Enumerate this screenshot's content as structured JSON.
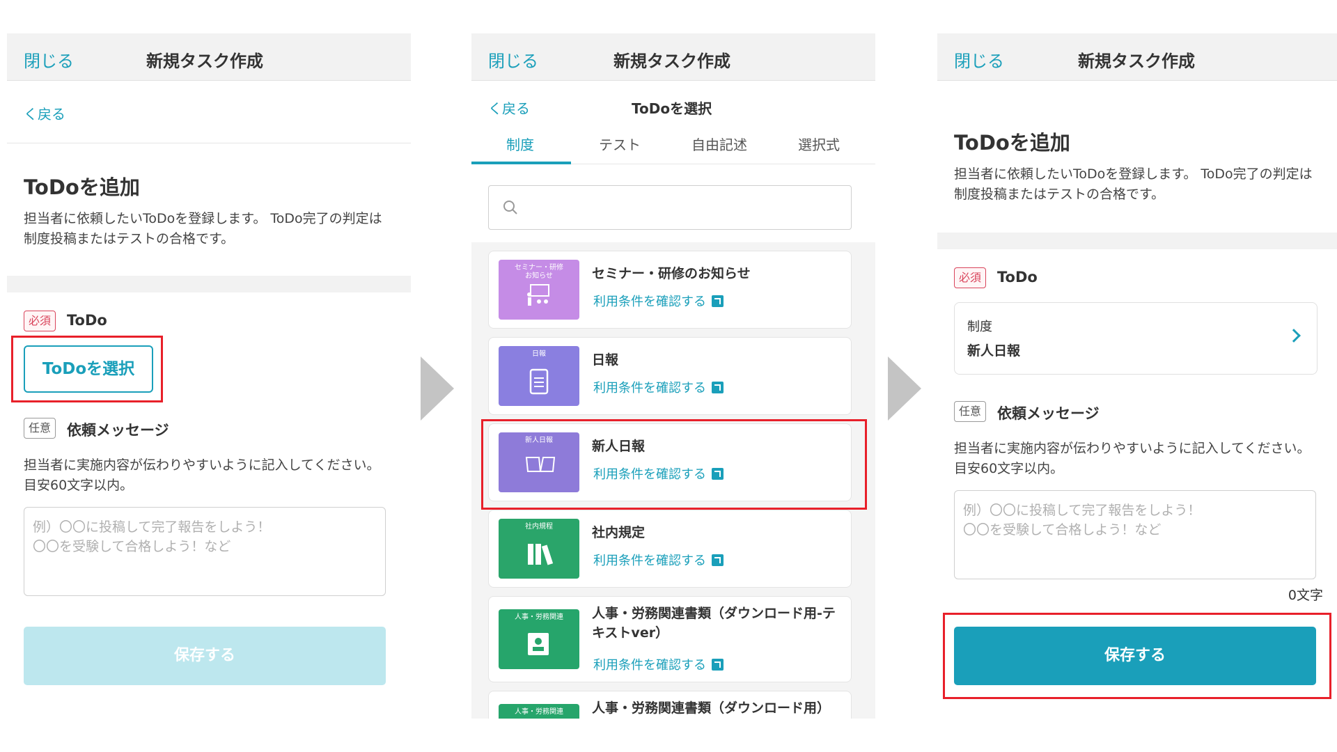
{
  "header": {
    "close_label": "閉じる",
    "title": "新規タスク作成"
  },
  "nav": {
    "back_label": "く戻る"
  },
  "add_section": {
    "title": "ToDoを追加",
    "description": "担当者に依頼したいToDoを登録します。 ToDo完了の判定は制度投稿またはテストの合格です。"
  },
  "todo_field": {
    "required_badge": "必須",
    "label": "ToDo",
    "select_button": "ToDoを選択"
  },
  "message_field": {
    "optional_badge": "任意",
    "label": "依頼メッセージ",
    "description": "担当者に実施内容が伝わりやすいように記入してください。目安60文字以内。",
    "placeholder": "例）〇〇に投稿して完了報告をしよう！\n〇〇を受験して合格しよう！など"
  },
  "save_label": "保存する",
  "char_count": "0文字",
  "picker": {
    "title": "ToDoを選択",
    "tabs": [
      "制度",
      "テスト",
      "自由記述",
      "選択式"
    ],
    "active_tab": "制度",
    "search_placeholder": "",
    "link_label": "利用条件を確認する",
    "items": [
      {
        "title": "セミナー・研修のお知らせ",
        "thumb_label": "セミナー・研修\nお知らせ",
        "thumb_color": "#c58ce6"
      },
      {
        "title": "日報",
        "thumb_label": "日報",
        "thumb_color": "#8a7fe0"
      },
      {
        "title": "新人日報",
        "thumb_label": "新人日報",
        "thumb_color": "#8e7bd9"
      },
      {
        "title": "社内規定",
        "thumb_label": "社内規程",
        "thumb_color": "#2aa56a"
      },
      {
        "title": "人事・労務関連書類（ダウンロード用-テキストver）",
        "thumb_label": "人事・労務関連",
        "thumb_color": "#26a56b"
      },
      {
        "title": "人事・労務関連書類（ダウンロード用）",
        "thumb_label": "人事・労務関連",
        "thumb_color": "#26a56b"
      }
    ]
  },
  "selected": {
    "category_label": "制度",
    "value": "新人日報"
  },
  "colors": {
    "accent": "#1a9fba",
    "required": "#d9445b",
    "highlight": "#e8202a"
  }
}
